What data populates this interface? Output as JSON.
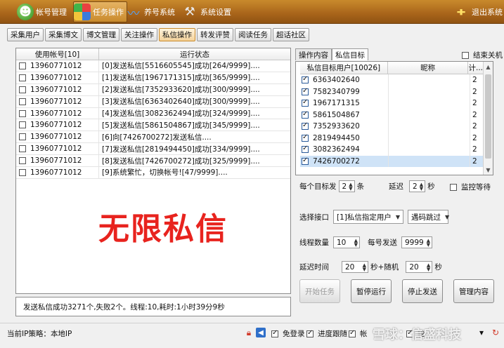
{
  "toolbar": {
    "items": [
      {
        "label": "帐号管理",
        "icon": "people-icon"
      },
      {
        "label": "任务操作",
        "icon": "task-icon"
      },
      {
        "label": "养号系统",
        "icon": "raise-icon"
      },
      {
        "label": "系统设置",
        "icon": "gear-icon"
      }
    ],
    "exit_label": "退出系统"
  },
  "tabs": [
    "采集用户",
    "采集博文",
    "博文管理",
    "关注操作",
    "私信操作",
    "转发评赞",
    "阅读任务",
    "超话社区"
  ],
  "active_tab": "私信操作",
  "left_table": {
    "headers": [
      "使用帐号[10]",
      "运行状态"
    ],
    "rows": [
      {
        "account": "13960771012",
        "status": "[0]发送私信[5516605545]成功[264/9999]...."
      },
      {
        "account": "13960771012",
        "status": "[1]发送私信[1967171315]成功[365/9999]...."
      },
      {
        "account": "13960771012",
        "status": "[2]发送私信[7352933620]成功[300/9999]...."
      },
      {
        "account": "13960771012",
        "status": "[3]发送私信[6363402640]成功[300/9999]...."
      },
      {
        "account": "13960771012",
        "status": "[4]发送私信[3082362494]成功[324/9999]...."
      },
      {
        "account": "13960771012",
        "status": "[5]发送私信[5861504867]成功[345/9999]...."
      },
      {
        "account": "13960771012",
        "status": "[6]向[7426700272]发送私信...."
      },
      {
        "account": "13960771012",
        "status": "[7]发送私信[2819494450]成功[334/9999]...."
      },
      {
        "account": "13960771012",
        "status": "[8]发送私信[7426700272]成功[325/9999]...."
      },
      {
        "account": "13960771012",
        "status": "[9]系统繁忙，切换帐号![47/9999]...."
      }
    ]
  },
  "overlay_text": "无限私信",
  "status_line": "发送私信成功3271个,失败2个。线程:10,耗时:1小时39分9秒",
  "right_tabs": [
    "操作内容",
    "私信目标"
  ],
  "active_right_tab": "私信目标",
  "shutdown_label": "结束关机",
  "right_table": {
    "headers": [
      "私信目标用户[10026]",
      "昵称",
      "计..."
    ],
    "rows": [
      {
        "uid": "6363402640",
        "nick": "",
        "count": "2"
      },
      {
        "uid": "7582340799",
        "nick": "",
        "count": "2"
      },
      {
        "uid": "1967171315",
        "nick": "",
        "count": "2"
      },
      {
        "uid": "5861504867",
        "nick": "",
        "count": "2"
      },
      {
        "uid": "7352933620",
        "nick": "",
        "count": "2"
      },
      {
        "uid": "2819494450",
        "nick": "",
        "count": "2"
      },
      {
        "uid": "3082362494",
        "nick": "",
        "count": "2"
      },
      {
        "uid": "7426700272",
        "nick": "",
        "count": "2"
      }
    ],
    "selected_index": 7
  },
  "per_target": {
    "prefix": "每个目标发",
    "value": "2",
    "unit": "条"
  },
  "delay": {
    "prefix": "延迟",
    "value": "2",
    "unit": "秒"
  },
  "monitor_wait_label": "监控等待",
  "interface": {
    "label": "选择接口",
    "value": "[1]私信指定用户",
    "captcha": "遇码跳过"
  },
  "threads": {
    "label": "线程数量",
    "value": "10"
  },
  "per_account": {
    "label": "每号发送",
    "value": "9999"
  },
  "delay_time": {
    "label": "延迟时间",
    "value": "20",
    "mid": "秒+随机",
    "value2": "20",
    "unit": "秒"
  },
  "buttons": {
    "start": "开始任务",
    "pause": "暂停运行",
    "stop": "停止发送",
    "manage": "管理内容"
  },
  "bottom": {
    "ip_label": "当前IP策略：",
    "ip_value": "本地IP",
    "checks": [
      {
        "label": "免登录",
        "checked": true
      },
      {
        "label": "进度跟随",
        "checked": true
      },
      {
        "label": "帐",
        "checked": true
      },
      {
        "label": "轮",
        "checked": true
      }
    ],
    "watermark": "雪球：信盛科技"
  }
}
